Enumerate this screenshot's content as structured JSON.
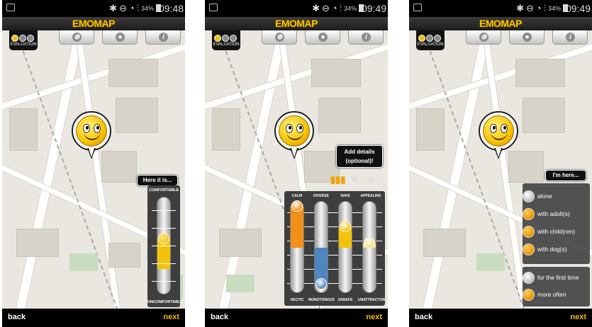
{
  "brand_color": "#f5c400",
  "screens": [
    {
      "status": {
        "signal": "34%",
        "time": "09:48"
      },
      "header": {
        "logo": "EMOMAP",
        "eval_label": "EVALUATION",
        "info_icon": "info-icon"
      },
      "callout": "Here it is...",
      "slider": {
        "top_label": "COMFORTABLE",
        "bottom_label": "UNCOMFORTABLE",
        "value_fraction": 0.57
      },
      "nav": {
        "back": "back",
        "next": "next"
      }
    },
    {
      "status": {
        "signal": "34%",
        "time": "09:49"
      },
      "header": {
        "logo": "EMOMAP",
        "eval_label": "EVALUATION",
        "info_icon": "info-icon"
      },
      "callout": "Add details (optional)!",
      "sliders": [
        {
          "top": "CALM",
          "bottom": "HECTIC",
          "value_fraction": 0.95,
          "color": "#f09018"
        },
        {
          "top": "DIVERSE",
          "bottom": "MONOTONOUS",
          "value_fraction": 0.1,
          "color": "#4f86c0"
        },
        {
          "top": "SAFE",
          "bottom": "UNSAFE",
          "value_fraction": 0.72,
          "color": "#f2c20a"
        },
        {
          "top": "APPEALING",
          "bottom": "UNATTRACTIVE",
          "value_fraction": 0.55,
          "color": "#f5e07a"
        }
      ],
      "nav": {
        "back": "back",
        "next": "next"
      }
    },
    {
      "status": {
        "signal": "34%",
        "time": "09:49"
      },
      "header": {
        "logo": "EMOMAP",
        "eval_label": "EVALUATION",
        "info_icon": "info-icon"
      },
      "callout": "I'm here...",
      "company_options": [
        {
          "label": "alone",
          "selected": false
        },
        {
          "label": "with adult(s)",
          "selected": true
        },
        {
          "label": "with child(ren)",
          "selected": true
        },
        {
          "label": "with dog(s)",
          "selected": true
        }
      ],
      "frequency_options": [
        {
          "label": "for the first time",
          "selected": false
        },
        {
          "label": "more often",
          "selected": true
        }
      ],
      "nav": {
        "back": "back",
        "next": "next"
      }
    }
  ]
}
